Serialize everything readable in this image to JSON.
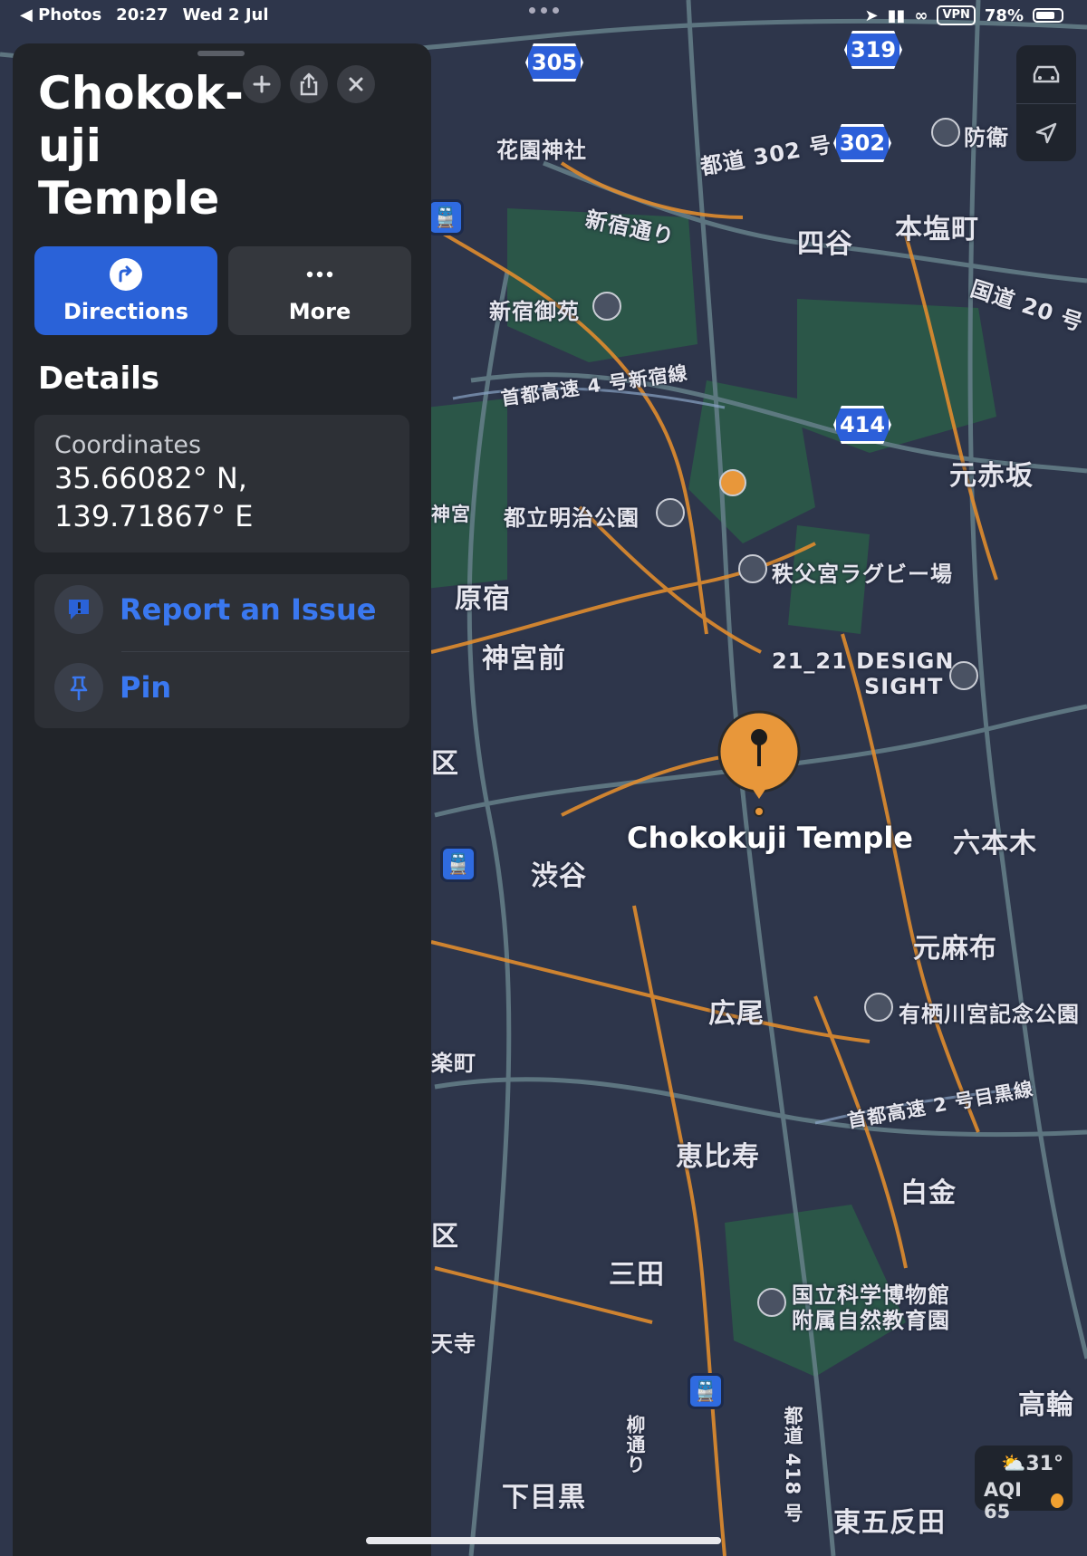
{
  "status_bar": {
    "back_app": "◀ Photos",
    "time": "20:27",
    "date": "Wed 2 Jul",
    "vpn": "VPN",
    "battery": "78%",
    "battery_level": 0.78
  },
  "place": {
    "title": "Chokok-uji Temple",
    "title_lines": [
      "Chokok-",
      "uji",
      "Temple"
    ]
  },
  "actions": {
    "directions_label": "Directions",
    "more_label": "More"
  },
  "details": {
    "heading": "Details",
    "coordinates_label": "Coordinates",
    "latitude": "35.66082° N,",
    "longitude": "139.71867° E"
  },
  "links": {
    "report_label": "Report an Issue",
    "pin_label": "Pin"
  },
  "map": {
    "pin_label": "Chokokuji Temple",
    "route_shields": [
      "305",
      "319",
      "302",
      "414"
    ],
    "labels": {
      "hanazono": "花園神社",
      "toto302": "都道 302 号",
      "shinjuku_dori": "新宿通り",
      "yotsuya": "四谷",
      "honshiocho": "本塩町",
      "kokudo20": "国道 20 号",
      "shinjuku_gyoen": "新宿御苑",
      "shutoko4": "首都高速 4 号新宿線",
      "motoakasaka": "元赤坂",
      "meiji_park": "都立明治公園",
      "chichibu": "秩父宮ラグビー場",
      "harajuku": "原宿",
      "jingumae": "神宮前",
      "design_sight_1": "21_21 DESIGN",
      "design_sight_2": "SIGHT",
      "roppongi": "六本木",
      "shibuya": "渋谷",
      "motoazabu": "元麻布",
      "hiroo": "広尾",
      "arisugawa": "有栖川宮記念公園",
      "shutoko2": "首都高速 2 号目黒線",
      "ebisu": "恵比寿",
      "shirokane": "白金",
      "mita": "三田",
      "science_1": "国立科学博物館",
      "science_2": "附属自然教育園",
      "takanawa": "高輪",
      "shimomeguro": "下目黒",
      "higashigotanda": "東五反田",
      "yanagi": "柳通り",
      "toto418": "都道 418 号",
      "boei": "防衛",
      "kaneku_1": "区",
      "kaneku_2": "区",
      "rakucho": "楽町",
      "tenji": "天寺",
      "jingu_edge": "神宮"
    }
  },
  "weather": {
    "temperature": "31°",
    "aqi": "AQI 65"
  },
  "colors": {
    "panel_bg": "#212429",
    "accent_blue": "#2a62d8",
    "link_blue": "#3a78f0",
    "pin_orange": "#e8973a",
    "map_bg": "#2e364b"
  }
}
